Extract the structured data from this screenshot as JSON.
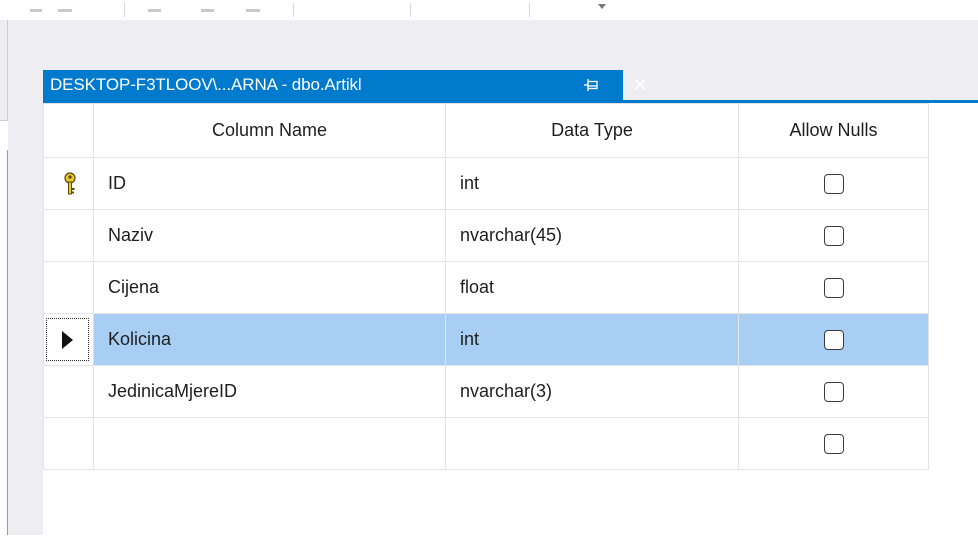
{
  "document_tab": {
    "title": "DESKTOP-F3TLOOV\\...ARNA - dbo.Artikl",
    "pin_icon": "pin-icon",
    "close_icon": "close-icon",
    "accent_color": "#007acc"
  },
  "grid": {
    "columns": [
      "Column Name",
      "Data Type",
      "Allow Nulls"
    ],
    "rows": [
      {
        "name": "ID",
        "type": "int",
        "allow_nulls": false,
        "primary_key": true,
        "selected": false
      },
      {
        "name": "Naziv",
        "type": "nvarchar(45)",
        "allow_nulls": false,
        "primary_key": false,
        "selected": false
      },
      {
        "name": "Cijena",
        "type": "float",
        "allow_nulls": false,
        "primary_key": false,
        "selected": false
      },
      {
        "name": "Kolicina",
        "type": "int",
        "allow_nulls": false,
        "primary_key": false,
        "selected": true
      },
      {
        "name": "JedinicaMjereID",
        "type": "nvarchar(3)",
        "allow_nulls": false,
        "primary_key": false,
        "selected": false
      },
      {
        "name": "",
        "type": "",
        "allow_nulls": false,
        "primary_key": false,
        "selected": false
      }
    ],
    "selection_color": "#a8cff3"
  }
}
